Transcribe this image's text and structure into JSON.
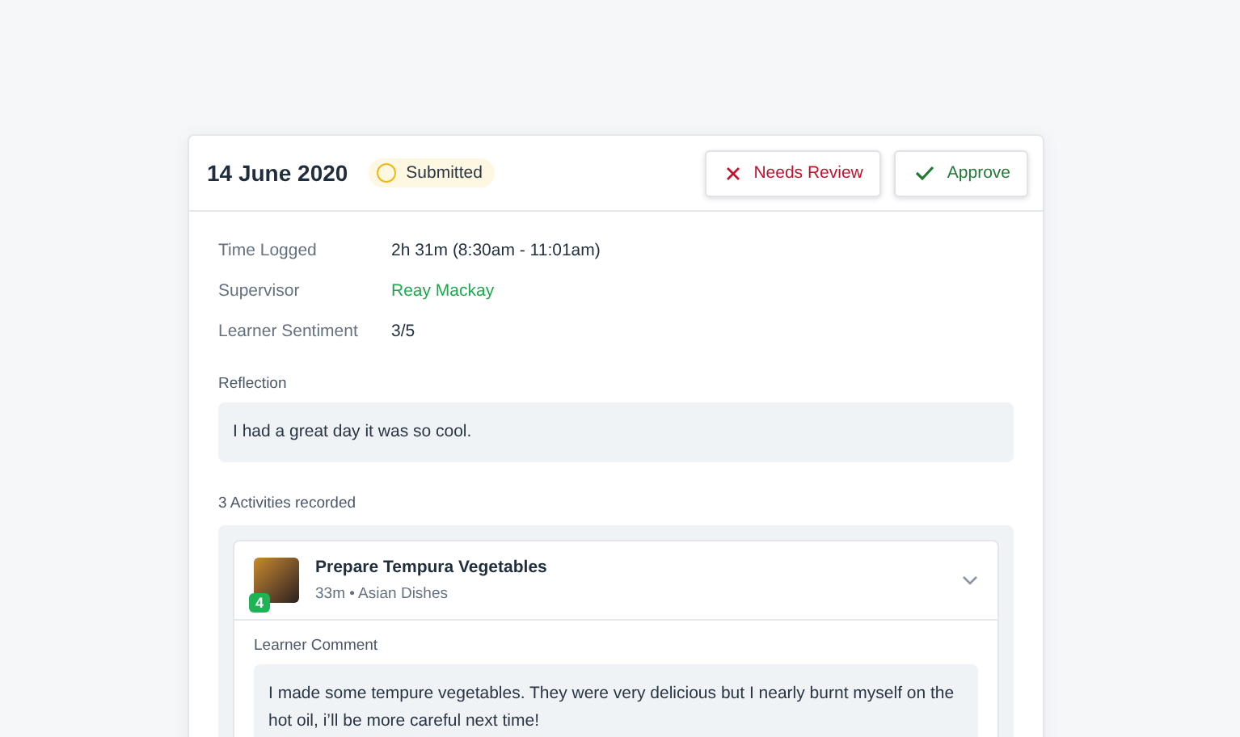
{
  "entry": {
    "date": "14 June 2020",
    "status": {
      "label": "Submitted",
      "kind": "pending"
    },
    "actions": [
      {
        "label": "Needs Review",
        "kind": "reject"
      },
      {
        "label": "Approve",
        "kind": "approve"
      }
    ],
    "details": [
      {
        "label": "Time Logged",
        "value": "2h 31m (8:30am - 11:01am)",
        "kind": "text"
      },
      {
        "label": "Supervisor",
        "value": "Reay Mackay",
        "kind": "link"
      },
      {
        "label": "Learner Sentiment",
        "value": "3/5",
        "kind": "text"
      }
    ],
    "reflection": {
      "label": "Reflection",
      "text": "I had a great day it was so cool."
    },
    "activities_heading": "3 Activities recorded",
    "activities": [
      {
        "title": "Prepare Tempura Vegetables",
        "meta": "33m • Asian Dishes",
        "count": "4",
        "expanded": true,
        "comment_label": "Learner Comment",
        "comment": "I made some tempure vegetables. They were very delicious but I nearly burnt myself on the hot oil, i’ll be more careful next time!"
      }
    ]
  }
}
